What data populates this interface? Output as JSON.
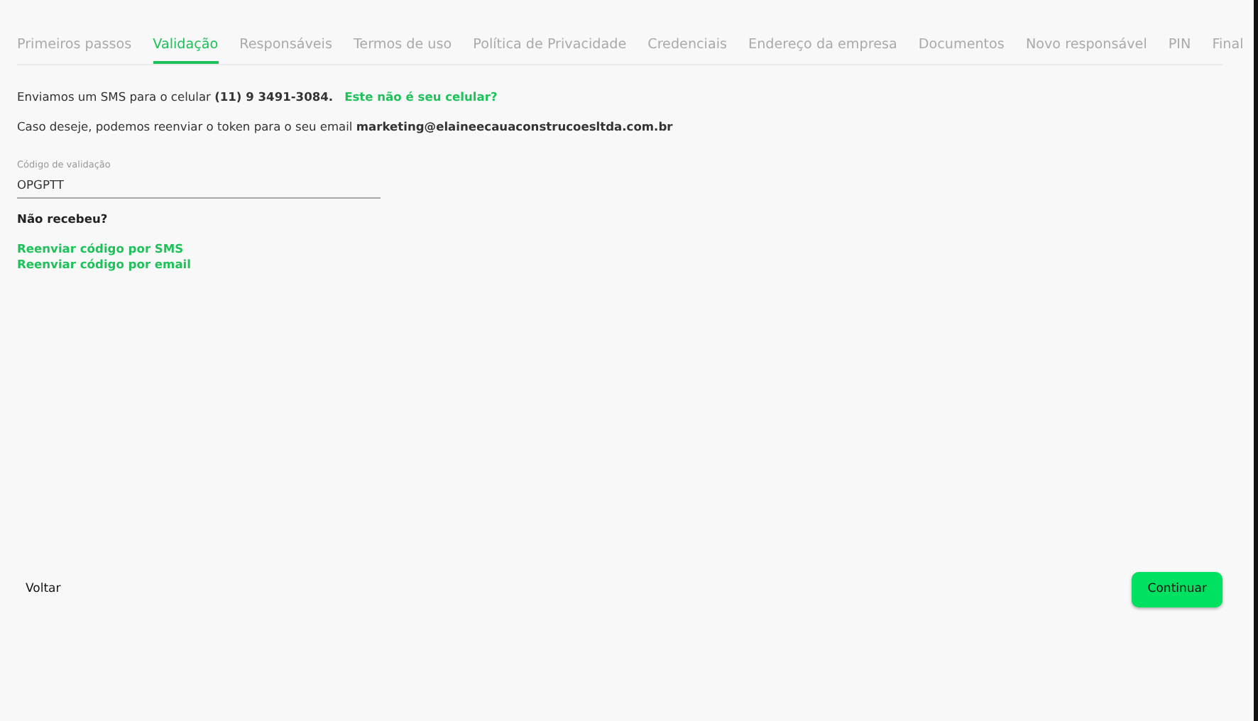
{
  "tabs": [
    {
      "label": "Primeiros passos",
      "selected": false
    },
    {
      "label": "Validação",
      "selected": true
    },
    {
      "label": "Responsáveis",
      "selected": false
    },
    {
      "label": "Termos de uso",
      "selected": false
    },
    {
      "label": "Política de Privacidade",
      "selected": false
    },
    {
      "label": "Credenciais",
      "selected": false
    },
    {
      "label": "Endereço da empresa",
      "selected": false
    },
    {
      "label": "Documentos",
      "selected": false
    },
    {
      "label": "Novo responsável",
      "selected": false
    },
    {
      "label": "PIN",
      "selected": false
    },
    {
      "label": "Final",
      "selected": false
    }
  ],
  "sms_message": "Enviamos um SMS para o celular **(11) 9 3491-3084.**",
  "wrong_phone_link": "Este não é seu celular?",
  "email_message": "Caso deseje, podemos reenviar o token para o seu email **marketing@elaineecauaconstrucoesltda.com.br**",
  "code_field": {
    "label": "Código de validação",
    "value": "OPGPTT"
  },
  "not_received": "Não recebeu?",
  "resend_links": [
    "Reenviar código por SMS",
    "Reenviar código por email"
  ],
  "back_button": "Voltar",
  "continue_button": "Continuar"
}
